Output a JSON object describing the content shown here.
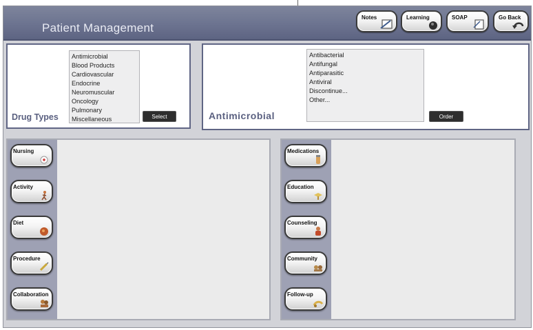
{
  "app": {
    "title": "Patient Management"
  },
  "toolbar": [
    {
      "label": "Notes",
      "icon": "notes-icon"
    },
    {
      "label": "Learning",
      "icon": "learning-icon"
    },
    {
      "label": "SOAP",
      "icon": "soap-icon"
    },
    {
      "label": "Go Back",
      "icon": "go-back-icon"
    }
  ],
  "drug_types": {
    "label": "Drug Types",
    "items": [
      "Antimicrobial",
      "Blood Products",
      "Cardiovascular",
      "Endocrine",
      "Neuromuscular",
      "Oncology",
      "Pulmonary",
      "Miscellaneous"
    ],
    "button": "Select"
  },
  "antimicrobial": {
    "label": "Antimicrobial",
    "items": [
      "Antibacterial",
      "Antifungal",
      "Antiparasitic",
      "Antiviral",
      "Discontinue...",
      "Other..."
    ],
    "button": "Order"
  },
  "left_tools": [
    {
      "label": "Nursing",
      "icon": "nursing-icon"
    },
    {
      "label": "Activity",
      "icon": "activity-icon"
    },
    {
      "label": "Diet",
      "icon": "diet-icon"
    },
    {
      "label": "Procedure",
      "icon": "procedure-icon"
    },
    {
      "label": "Collaboration",
      "icon": "collaboration-icon"
    }
  ],
  "right_tools": [
    {
      "label": "Medications",
      "icon": "medications-icon"
    },
    {
      "label": "Education",
      "icon": "education-icon"
    },
    {
      "label": "Counseling",
      "icon": "counseling-icon"
    },
    {
      "label": "Community",
      "icon": "community-icon"
    },
    {
      "label": "Follow-up",
      "icon": "follow-up-icon"
    }
  ],
  "colors": {
    "header": "#6c7390",
    "panel_border": "#5f6584",
    "label_text": "#5a6080",
    "side_strip": "#9ea1b4",
    "content_bg": "#ebebeb"
  }
}
